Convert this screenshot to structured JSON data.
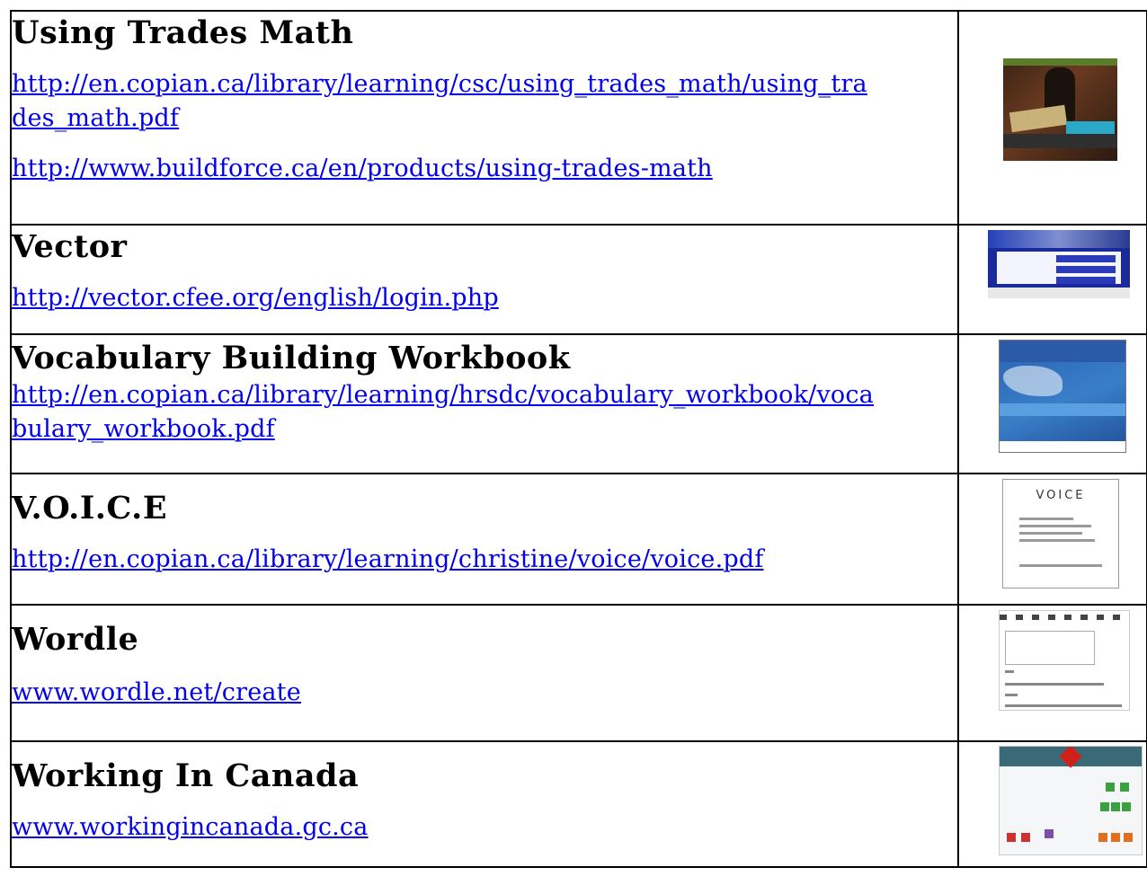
{
  "rows": [
    {
      "title": "Using Trades Math",
      "links": [
        "http://en.copian.ca/library/learning/csc/using_trades_math/using_trades_math.pdf",
        "http://www.buildforce.ca/en/products/using-trades-math"
      ],
      "link_lines": [
        "http://en.copian.ca/library/learning/csc/using_trades_math/using_tra",
        "des_math.pdf",
        "http://www.buildforce.ca/en/products/using-trades-math"
      ],
      "thumbnail": "using-trades-math-cover"
    },
    {
      "title": "Vector",
      "links": [
        "http://vector.cfee.org/english/login.php"
      ],
      "thumbnail": "vector-login-screenshot"
    },
    {
      "title": "Vocabulary Building Workbook",
      "links": [
        "http://en.copian.ca/library/learning/hrsdc/vocabulary_workbook/vocabulary_workbook.pdf"
      ],
      "link_lines": [
        "http://en.copian.ca/library/learning/hrsdc/vocabulary_workbook/voca",
        "bulary_workbook.pdf"
      ],
      "thumbnail": "vocabulary-workbook-cover"
    },
    {
      "title": "V.O.I.C.E",
      "links": [
        "http://en.copian.ca/library/learning/christine/voice/voice.pdf"
      ],
      "thumbnail": "voice-cover",
      "thumbnail_text": "VOICE"
    },
    {
      "title": "Wordle",
      "links": [
        "www.wordle.net/create"
      ],
      "thumbnail": "wordle-create-screenshot"
    },
    {
      "title": "Working In Canada",
      "links": [
        "www.workingincanada.gc.ca"
      ],
      "thumbnail": "working-in-canada-screenshot"
    }
  ]
}
